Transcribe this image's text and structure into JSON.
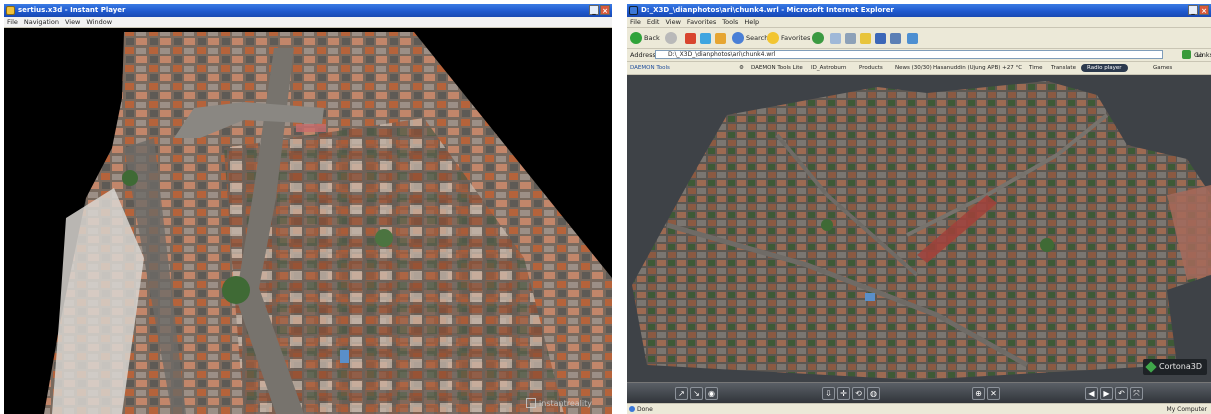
{
  "left_window": {
    "title": "sertius.x3d - Instant Player",
    "window_buttons": [
      "_",
      "×"
    ],
    "menu": [
      "File",
      "Navigation",
      "View",
      "Window"
    ],
    "watermark": "instantreality"
  },
  "right_window": {
    "title": "D:_X3D_\\dianphotos\\ari\\chunk4.wrl - Microsoft Internet Explorer",
    "window_buttons": [
      "_",
      "×"
    ],
    "menu": [
      "File",
      "Edit",
      "View",
      "Favorites",
      "Tools",
      "Help"
    ],
    "toolbar": {
      "back": "Back",
      "search": "Search",
      "favorites": "Favorites"
    },
    "address": {
      "label": "Address",
      "value": "D:\\_X3D_\\dianphotos\\ari\\chunk4.wrl",
      "go": "Go",
      "links": "Links"
    },
    "links_bar": {
      "daemon": "DAEMON Tools",
      "daemon_lite": "DAEMON Tools Lite",
      "astroburn": "ID_Astroburn",
      "products": "Products",
      "news": "News (30/30)",
      "weather": "Hasanuddin (Ujung APB) +27 °C",
      "time": "Time",
      "translate": "Translate",
      "radio": "Radio player",
      "games": "Games"
    },
    "player_logo": "Cortona3D",
    "status": {
      "left": "Done",
      "right": "My Computer"
    }
  },
  "colors": {
    "titlebar": "#1f59cf",
    "chrome": "#ece9d8",
    "viewer_bg": "#3e4247",
    "roof_orange": "#b5633b",
    "vegetation": "#3f6a35",
    "road": "#6f6b66"
  }
}
